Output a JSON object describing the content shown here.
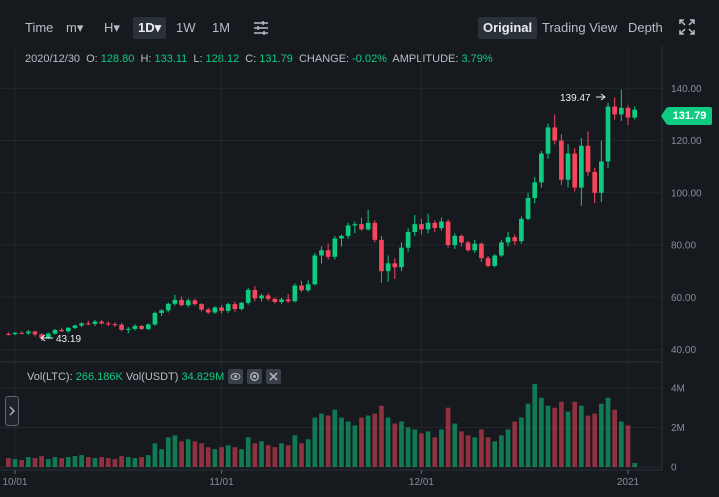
{
  "toolbar": {
    "time": "Time",
    "minute": "m▾",
    "hour": "H▾",
    "day": "1D▾",
    "week": "1W",
    "month": "1M",
    "original": "Original",
    "tradingview": "Trading View",
    "depth": "Depth"
  },
  "ohlc": {
    "date": "2020/12/30",
    "open_label": "O:",
    "open": "128.80",
    "high_label": "H:",
    "high": "133.11",
    "low_label": "L:",
    "low": "128.12",
    "close_label": "C:",
    "close": "131.79",
    "change_label": "CHANGE:",
    "change": "-0.02%",
    "amplitude_label": "AMPLITUDE:",
    "amplitude": "3.79%"
  },
  "volume_legend": {
    "ltc_label": "Vol(LTC):",
    "ltc": "266.186K",
    "usdt_label": "Vol(USDT)",
    "usdt": "34.829M"
  },
  "last_price": "131.79",
  "markers": {
    "high": "139.47",
    "low": "43.19"
  },
  "colors": {
    "up": "#0ecb81",
    "down": "#f6465d",
    "bg": "#161a1e",
    "grid": "#22272e"
  },
  "chart_data": {
    "type": "candlestick",
    "y_ticks": [
      "140.00",
      "120.00",
      "100.00",
      "80.00",
      "60.00",
      "40.00"
    ],
    "y_tick_values": [
      140,
      120,
      100,
      80,
      60,
      40
    ],
    "ylim": [
      36,
      147
    ],
    "x_ticks": [
      "10/01",
      "11/01",
      "12/01",
      "2021"
    ],
    "x_tick_index": [
      1,
      32,
      62,
      93
    ],
    "vol_ticks": [
      "4M",
      "2M",
      "0"
    ],
    "vol_tick_values": [
      4,
      2,
      0
    ],
    "vol_ylim": [
      0,
      4.4
    ],
    "candles": [
      [
        46.0,
        46.6,
        45.4,
        45.9
      ],
      [
        45.9,
        46.8,
        45.5,
        46.4
      ],
      [
        46.4,
        47.0,
        45.9,
        46.2
      ],
      [
        46.2,
        47.5,
        45.5,
        46.9
      ],
      [
        46.9,
        47.2,
        45.0,
        45.8
      ],
      [
        45.8,
        46.3,
        43.2,
        44.5
      ],
      [
        44.5,
        46.5,
        44.0,
        46.1
      ],
      [
        46.1,
        47.9,
        45.7,
        47.5
      ],
      [
        47.5,
        48.4,
        46.8,
        47.0
      ],
      [
        47.0,
        48.6,
        46.5,
        48.3
      ],
      [
        48.3,
        49.5,
        47.8,
        49.2
      ],
      [
        49.2,
        50.5,
        48.6,
        50.0
      ],
      [
        50.0,
        51.0,
        49.2,
        49.8
      ],
      [
        49.8,
        51.3,
        49.0,
        50.7
      ],
      [
        50.7,
        51.4,
        49.5,
        50.0
      ],
      [
        50.0,
        50.8,
        49.0,
        49.7
      ],
      [
        49.7,
        50.5,
        48.7,
        49.5
      ],
      [
        49.5,
        50.2,
        47.0,
        47.6
      ],
      [
        47.6,
        48.6,
        46.2,
        47.9
      ],
      [
        47.9,
        49.8,
        47.3,
        49.0
      ],
      [
        49.0,
        49.4,
        47.5,
        47.9
      ],
      [
        47.9,
        50.0,
        47.4,
        49.6
      ],
      [
        49.6,
        54.5,
        49.1,
        54.0
      ],
      [
        54.0,
        55.5,
        52.8,
        55.0
      ],
      [
        55.0,
        58.0,
        54.2,
        57.5
      ],
      [
        57.5,
        61.0,
        56.8,
        59.0
      ],
      [
        59.0,
        60.2,
        56.5,
        57.0
      ],
      [
        57.0,
        59.5,
        56.2,
        58.8
      ],
      [
        58.8,
        59.5,
        56.8,
        57.4
      ],
      [
        57.4,
        57.8,
        54.6,
        55.3
      ],
      [
        55.3,
        56.0,
        53.6,
        54.2
      ],
      [
        54.2,
        56.6,
        53.7,
        56.1
      ],
      [
        56.1,
        57.1,
        53.8,
        54.8
      ],
      [
        54.8,
        58.0,
        54.0,
        57.4
      ],
      [
        57.4,
        58.3,
        54.4,
        55.5
      ],
      [
        55.5,
        58.2,
        54.9,
        57.9
      ],
      [
        57.9,
        63.5,
        57.2,
        62.8
      ],
      [
        62.8,
        64.2,
        58.5,
        59.6
      ],
      [
        59.6,
        61.4,
        58.4,
        60.7
      ],
      [
        60.7,
        61.5,
        58.6,
        59.4
      ],
      [
        59.4,
        59.9,
        57.6,
        58.2
      ],
      [
        58.2,
        59.8,
        57.4,
        59.2
      ],
      [
        59.2,
        61.2,
        57.8,
        58.5
      ],
      [
        58.5,
        65.3,
        58.0,
        64.5
      ],
      [
        64.5,
        66.3,
        62.0,
        62.7
      ],
      [
        62.7,
        66.5,
        62.0,
        65.0
      ],
      [
        65.0,
        77.0,
        64.5,
        76.0
      ],
      [
        76.0,
        79.5,
        73.0,
        78.0
      ],
      [
        78.0,
        80.5,
        74.5,
        75.5
      ],
      [
        75.5,
        83.5,
        74.5,
        82.5
      ],
      [
        82.5,
        84.0,
        79.5,
        83.5
      ],
      [
        83.5,
        88.5,
        82.5,
        87.5
      ],
      [
        87.5,
        89.0,
        84.5,
        88.0
      ],
      [
        88.0,
        90.5,
        85.5,
        86.0
      ],
      [
        86.0,
        93.5,
        85.5,
        88.5
      ],
      [
        88.5,
        89.5,
        81.0,
        82.0
      ],
      [
        82.0,
        83.5,
        65.5,
        70.0
      ],
      [
        70.0,
        76.0,
        66.0,
        73.0
      ],
      [
        73.0,
        75.0,
        67.0,
        71.5
      ],
      [
        71.5,
        81.0,
        70.0,
        79.0
      ],
      [
        79.0,
        86.5,
        77.5,
        85.0
      ],
      [
        85.0,
        91.5,
        83.5,
        88.0
      ],
      [
        88.0,
        90.0,
        84.0,
        86.0
      ],
      [
        86.0,
        92.0,
        84.5,
        88.5
      ],
      [
        88.5,
        89.5,
        85.0,
        86.5
      ],
      [
        86.5,
        90.5,
        85.5,
        89.0
      ],
      [
        89.0,
        89.8,
        79.0,
        80.0
      ],
      [
        80.0,
        84.5,
        78.5,
        83.5
      ],
      [
        83.5,
        84.0,
        79.5,
        81.0
      ],
      [
        81.0,
        81.5,
        77.5,
        78.0
      ],
      [
        78.0,
        82.0,
        77.0,
        80.5
      ],
      [
        80.5,
        81.0,
        73.5,
        75.0
      ],
      [
        75.0,
        75.8,
        71.5,
        72.0
      ],
      [
        72.0,
        76.5,
        71.5,
        76.0
      ],
      [
        76.0,
        82.0,
        75.5,
        81.0
      ],
      [
        81.0,
        85.0,
        79.5,
        83.0
      ],
      [
        83.0,
        84.0,
        80.0,
        81.5
      ],
      [
        81.5,
        91.0,
        80.5,
        90.0
      ],
      [
        90.0,
        100.0,
        89.5,
        98.0
      ],
      [
        98.0,
        106.0,
        96.0,
        104.0
      ],
      [
        104.0,
        116.0,
        102.0,
        115.0
      ],
      [
        115.0,
        126.5,
        113.0,
        125.0
      ],
      [
        125.0,
        130.0,
        118.5,
        120.0
      ],
      [
        120.0,
        122.5,
        103.0,
        105.0
      ],
      [
        105.0,
        118.5,
        102.0,
        115.0
      ],
      [
        115.0,
        117.0,
        100.5,
        102.0
      ],
      [
        102.0,
        121.0,
        95.0,
        118.0
      ],
      [
        118.0,
        123.5,
        106.5,
        108.0
      ],
      [
        108.0,
        109.5,
        96.0,
        100.0
      ],
      [
        100.0,
        120.0,
        96.5,
        112.0
      ],
      [
        112.0,
        134.5,
        109.5,
        133.0
      ],
      [
        133.0,
        136.5,
        128.0,
        130.0
      ],
      [
        130.0,
        139.5,
        127.5,
        132.5
      ],
      [
        132.5,
        133.5,
        126.0,
        128.8
      ],
      [
        128.8,
        133.1,
        128.1,
        131.8
      ]
    ],
    "volumes": [
      0.45,
      0.4,
      0.35,
      0.5,
      0.45,
      0.55,
      0.4,
      0.5,
      0.45,
      0.5,
      0.55,
      0.6,
      0.5,
      0.45,
      0.5,
      0.45,
      0.4,
      0.55,
      0.5,
      0.45,
      0.5,
      0.6,
      1.2,
      0.9,
      1.5,
      1.6,
      1.3,
      1.4,
      1.3,
      1.2,
      1.0,
      0.9,
      1.0,
      1.1,
      1.0,
      0.9,
      1.5,
      1.2,
      1.3,
      1.1,
      1.0,
      1.2,
      1.1,
      1.6,
      1.2,
      1.4,
      2.5,
      2.7,
      2.6,
      2.9,
      2.5,
      2.3,
      2.1,
      2.5,
      2.6,
      2.7,
      3.1,
      2.5,
      2.2,
      2.3,
      2.0,
      1.9,
      1.7,
      1.8,
      1.5,
      1.9,
      3.0,
      2.2,
      1.8,
      1.6,
      1.5,
      1.9,
      1.5,
      1.3,
      1.6,
      1.9,
      2.3,
      2.5,
      3.2,
      4.2,
      3.5,
      3.1,
      3.0,
      3.3,
      2.8,
      3.3,
      3.1,
      2.6,
      2.7,
      3.2,
      3.5,
      2.9,
      2.3,
      2.1,
      0.2
    ]
  }
}
